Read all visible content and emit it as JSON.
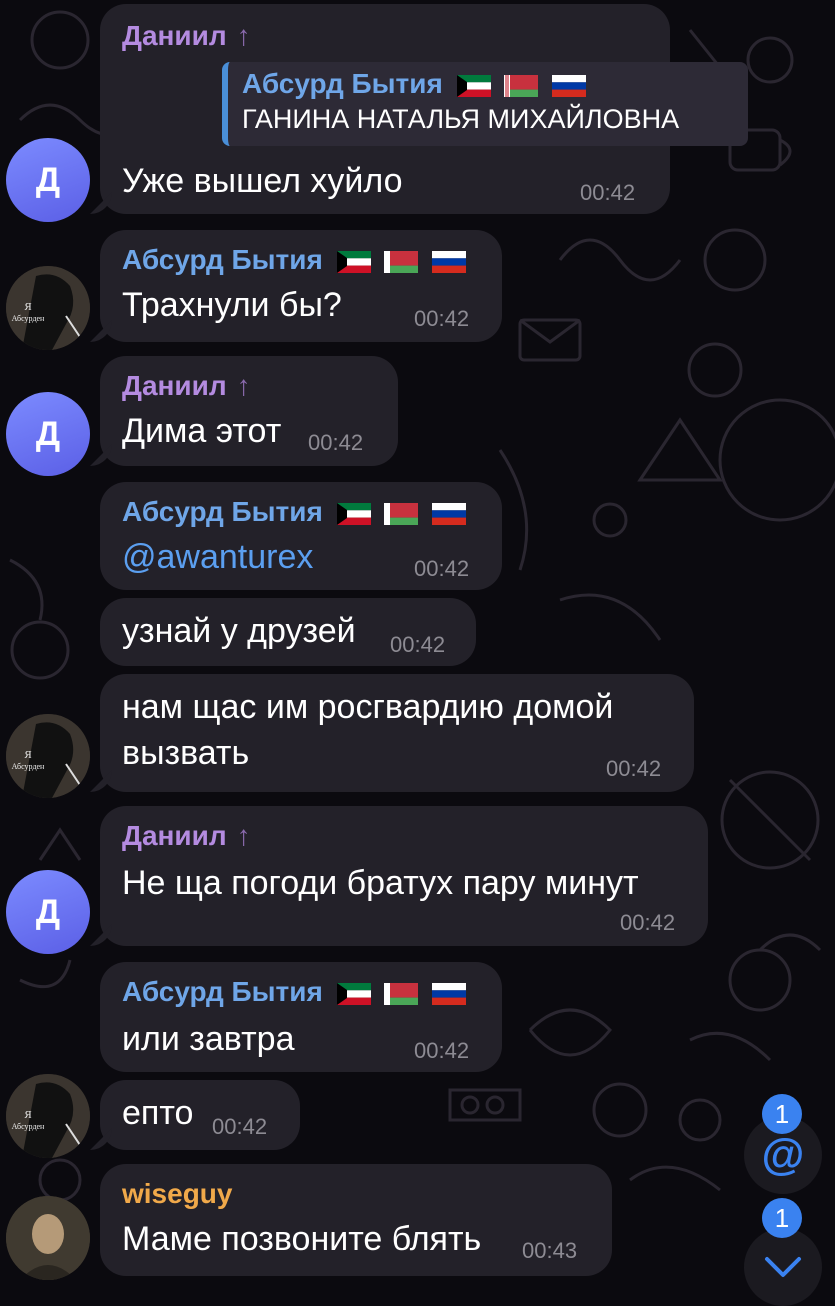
{
  "messages": [
    {
      "sender": "Даниил",
      "reply_title": "Абсурд Бытия",
      "reply_text": "ГАНИНА НАТАЛЬЯ МИХАЙЛОВНА",
      "text": "Уже вышел хуйло",
      "time": "00:42"
    },
    {
      "sender": "Абсурд Бытия",
      "text": "Трахнули бы?",
      "time": "00:42"
    },
    {
      "sender": "Даниил",
      "text": "Дима этот",
      "time": "00:42"
    },
    {
      "sender": "Абсурд Бытия",
      "text": "@awanturex",
      "time": "00:42"
    },
    {
      "text": "узнай у друзей",
      "time": "00:42"
    },
    {
      "text_line1": "нам щас им росгвардию домой",
      "text_line2": "вызвать",
      "time": "00:42"
    },
    {
      "sender": "Даниил",
      "text": "Не ща погоди братух пару минут",
      "time": "00:42"
    },
    {
      "sender": "Абсурд Бытия",
      "text": "или завтра",
      "time": "00:42"
    },
    {
      "text": "епто",
      "time": "00:42"
    },
    {
      "sender": "wiseguy",
      "text": "Маме позвоните блять",
      "time": "00:43"
    }
  ],
  "avatars": {
    "daniil_letter": "Д",
    "absurd_caption_1": "Я",
    "absurd_caption_2": "Абсурден"
  },
  "fab": {
    "mentions_count": "1",
    "unread_count": "1",
    "mention_icon": "at-icon",
    "down_icon": "chevron-down-icon"
  },
  "colors": {
    "bubble": "#232129",
    "accent_blue": "#3a82f0",
    "name_purple": "#b48be0",
    "name_blue": "#6fa6e8",
    "name_orange": "#f0a94a"
  }
}
